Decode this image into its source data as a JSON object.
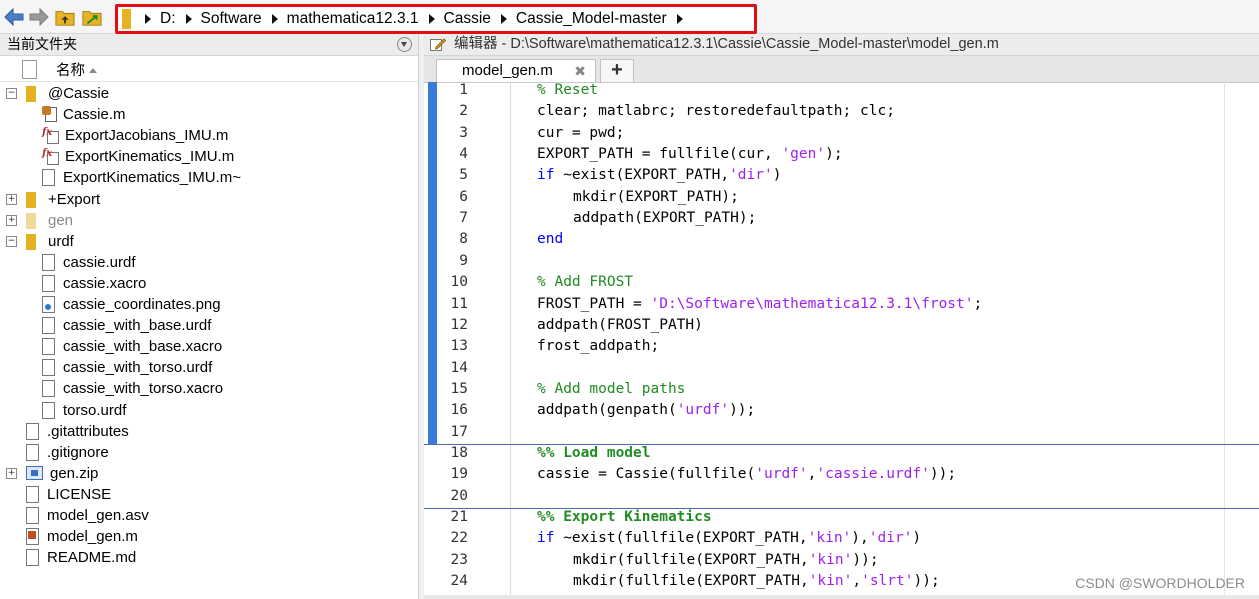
{
  "address_bar": {
    "crumbs": [
      "D:",
      "Software",
      "mathematica12.3.1",
      "Cassie",
      "Cassie_Model-master"
    ]
  },
  "file_panel": {
    "title": "当前文件夹",
    "column_header": "名称",
    "items": [
      {
        "label": "@Cassie",
        "depth": 0,
        "kind": "folder",
        "expander": "minus"
      },
      {
        "label": "Cassie.m",
        "depth": 1,
        "kind": "class"
      },
      {
        "label": "ExportJacobians_IMU.m",
        "depth": 1,
        "kind": "function"
      },
      {
        "label": "ExportKinematics_IMU.m",
        "depth": 1,
        "kind": "function"
      },
      {
        "label": "ExportKinematics_IMU.m~",
        "depth": 1,
        "kind": "file"
      },
      {
        "label": "+Export",
        "depth": 0,
        "kind": "folder",
        "expander": "plus"
      },
      {
        "label": "gen",
        "depth": 0,
        "kind": "folder-grey",
        "expander": "plus"
      },
      {
        "label": "urdf",
        "depth": 0,
        "kind": "folder",
        "expander": "minus"
      },
      {
        "label": "cassie.urdf",
        "depth": 1,
        "kind": "file"
      },
      {
        "label": "cassie.xacro",
        "depth": 1,
        "kind": "file"
      },
      {
        "label": "cassie_coordinates.png",
        "depth": 1,
        "kind": "png"
      },
      {
        "label": "cassie_with_base.urdf",
        "depth": 1,
        "kind": "file"
      },
      {
        "label": "cassie_with_base.xacro",
        "depth": 1,
        "kind": "file"
      },
      {
        "label": "cassie_with_torso.urdf",
        "depth": 1,
        "kind": "file"
      },
      {
        "label": "cassie_with_torso.xacro",
        "depth": 1,
        "kind": "file"
      },
      {
        "label": "torso.urdf",
        "depth": 1,
        "kind": "file"
      },
      {
        "label": ".gitattributes",
        "depth": 0,
        "kind": "file"
      },
      {
        "label": ".gitignore",
        "depth": 0,
        "kind": "file"
      },
      {
        "label": "gen.zip",
        "depth": 0,
        "kind": "zip",
        "expander": "plus"
      },
      {
        "label": "LICENSE",
        "depth": 0,
        "kind": "file"
      },
      {
        "label": "model_gen.asv",
        "depth": 0,
        "kind": "file"
      },
      {
        "label": "model_gen.m",
        "depth": 0,
        "kind": "mfile"
      },
      {
        "label": "README.md",
        "depth": 0,
        "kind": "file"
      }
    ]
  },
  "editor": {
    "title": "编辑器 - D:\\Software\\mathematica12.3.1\\Cassie\\Cassie_Model-master\\model_gen.m",
    "tab_label": "model_gen.m",
    "tab_close": "✖",
    "new_tab": "+",
    "lines": [
      {
        "n": "1",
        "indent": 0,
        "parts": [
          {
            "t": "% Reset",
            "c": "cm"
          }
        ]
      },
      {
        "n": "2",
        "indent": 0,
        "parts": [
          {
            "t": "clear; matlabrc; restoredefaultpath; clc;",
            "c": ""
          }
        ]
      },
      {
        "n": "3",
        "indent": 0,
        "parts": [
          {
            "t": "cur = pwd;",
            "c": ""
          }
        ]
      },
      {
        "n": "4",
        "indent": 0,
        "parts": [
          {
            "t": "EXPORT_PATH = fullfile(cur, ",
            "c": ""
          },
          {
            "t": "'gen'",
            "c": "st"
          },
          {
            "t": ");",
            "c": ""
          }
        ]
      },
      {
        "n": "5",
        "indent": 0,
        "parts": [
          {
            "t": "if",
            "c": "kw"
          },
          {
            "t": " ~exist(EXPORT_PATH,",
            "c": ""
          },
          {
            "t": "'dir'",
            "c": "st"
          },
          {
            "t": ")",
            "c": ""
          }
        ]
      },
      {
        "n": "6",
        "indent": 1,
        "parts": [
          {
            "t": "mkdir(EXPORT_PATH);",
            "c": ""
          }
        ]
      },
      {
        "n": "7",
        "indent": 1,
        "parts": [
          {
            "t": "addpath(EXPORT_PATH);",
            "c": ""
          }
        ]
      },
      {
        "n": "8",
        "indent": 0,
        "parts": [
          {
            "t": "end",
            "c": "kw"
          }
        ]
      },
      {
        "n": "9",
        "indent": 0,
        "parts": []
      },
      {
        "n": "10",
        "indent": 0,
        "parts": [
          {
            "t": "% Add FROST",
            "c": "cm"
          }
        ]
      },
      {
        "n": "11",
        "indent": 0,
        "parts": [
          {
            "t": "FROST_PATH = ",
            "c": ""
          },
          {
            "t": "'D:\\Software\\mathematica12.3.1\\frost'",
            "c": "st"
          },
          {
            "t": ";",
            "c": ""
          }
        ]
      },
      {
        "n": "12",
        "indent": 0,
        "parts": [
          {
            "t": "addpath(FROST_PATH)",
            "c": ""
          }
        ]
      },
      {
        "n": "13",
        "indent": 0,
        "parts": [
          {
            "t": "frost_addpath;",
            "c": ""
          }
        ]
      },
      {
        "n": "14",
        "indent": 0,
        "parts": []
      },
      {
        "n": "15",
        "indent": 0,
        "parts": [
          {
            "t": "% Add model paths",
            "c": "cm"
          }
        ]
      },
      {
        "n": "16",
        "indent": 0,
        "parts": [
          {
            "t": "addpath(genpath(",
            "c": ""
          },
          {
            "t": "'urdf'",
            "c": "st"
          },
          {
            "t": "));",
            "c": ""
          }
        ]
      },
      {
        "n": "17",
        "indent": 0,
        "parts": []
      },
      {
        "n": "18",
        "indent": 0,
        "parts": [
          {
            "t": "%% Load model",
            "c": "cm bold"
          }
        ]
      },
      {
        "n": "19",
        "indent": 0,
        "parts": [
          {
            "t": "cassie = Cassie(fullfile(",
            "c": ""
          },
          {
            "t": "'urdf'",
            "c": "st"
          },
          {
            "t": ",",
            "c": ""
          },
          {
            "t": "'cassie.urdf'",
            "c": "st"
          },
          {
            "t": "));",
            "c": ""
          }
        ]
      },
      {
        "n": "20",
        "indent": 0,
        "parts": []
      },
      {
        "n": "21",
        "indent": 0,
        "parts": [
          {
            "t": "%% Export Kinematics",
            "c": "cm bold"
          }
        ]
      },
      {
        "n": "22",
        "indent": 0,
        "parts": [
          {
            "t": "if",
            "c": "kw"
          },
          {
            "t": " ~exist(fullfile(EXPORT_PATH,",
            "c": ""
          },
          {
            "t": "'kin'",
            "c": "st"
          },
          {
            "t": "),",
            "c": ""
          },
          {
            "t": "'dir'",
            "c": "st"
          },
          {
            "t": ")",
            "c": ""
          }
        ]
      },
      {
        "n": "23",
        "indent": 1,
        "parts": [
          {
            "t": "mkdir(fullfile(EXPORT_PATH,",
            "c": ""
          },
          {
            "t": "'kin'",
            "c": "st"
          },
          {
            "t": "));",
            "c": ""
          }
        ]
      },
      {
        "n": "24",
        "indent": 1,
        "parts": [
          {
            "t": "mkdir(fullfile(EXPORT_PATH,",
            "c": ""
          },
          {
            "t": "'kin'",
            "c": "st"
          },
          {
            "t": ",",
            "c": ""
          },
          {
            "t": "'slrt'",
            "c": "st"
          },
          {
            "t": "));",
            "c": ""
          }
        ]
      }
    ]
  },
  "watermark": "CSDN @SWORDHOLDER",
  "colors": {
    "highlight_border": "#e01010",
    "comment": "#228b22",
    "keyword": "#0000ff",
    "string": "#a020f0",
    "cell_bar": "#3a7ad8"
  }
}
